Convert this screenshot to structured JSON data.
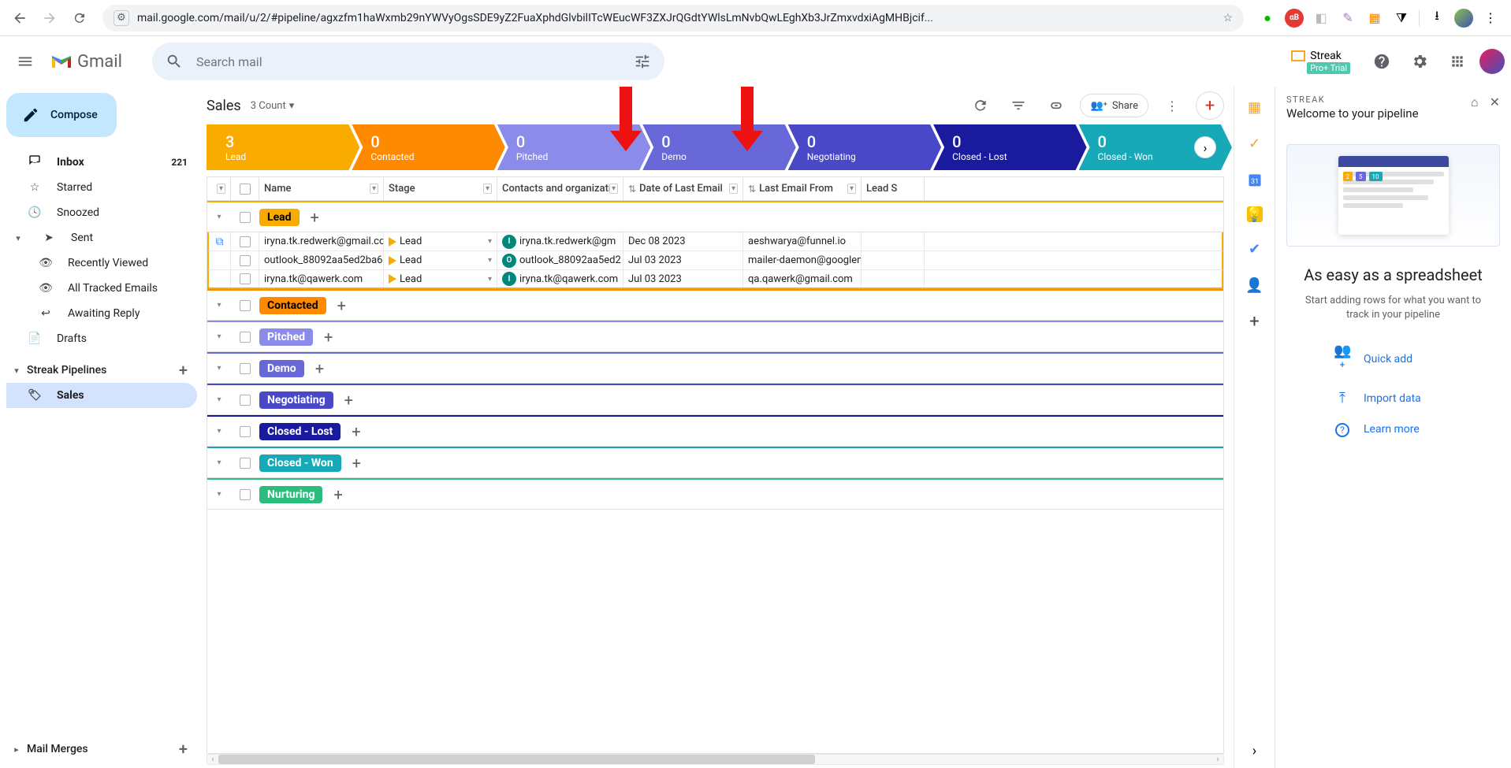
{
  "browser": {
    "url": "mail.google.com/mail/u/2/#pipeline/agxzfm1haWxmb29nYWVyOgsSDE9yZ2FuaXphdGlvbilITcWEucWF3ZXJrQGdtYWlsLmNvbQwLEghXb3JrZmxvdxiAgMHBjcif..."
  },
  "header": {
    "product": "Gmail",
    "search_placeholder": "Search mail",
    "streak_label": "Streak",
    "streak_trial": "Pro+ Trial"
  },
  "sidebar": {
    "compose": "Compose",
    "items": [
      {
        "icon": "inbox",
        "label": "Inbox",
        "count": "221",
        "active": true
      },
      {
        "icon": "star",
        "label": "Starred"
      },
      {
        "icon": "clock",
        "label": "Snoozed"
      },
      {
        "icon": "send",
        "label": "Sent"
      },
      {
        "icon": "eye",
        "label": "Recently Viewed",
        "indent": true
      },
      {
        "icon": "tracked",
        "label": "All Tracked Emails",
        "indent": true
      },
      {
        "icon": "reply",
        "label": "Awaiting Reply",
        "indent": true
      },
      {
        "icon": "draft",
        "label": "Drafts"
      }
    ],
    "pipelines_label": "Streak Pipelines",
    "pipeline_items": [
      {
        "icon": "tag",
        "label": "Sales",
        "active": true
      }
    ],
    "footer_label": "Mail Merges"
  },
  "main": {
    "title": "Sales",
    "count_text": "3 Count",
    "share_label": "Share"
  },
  "funnel": [
    {
      "count": "3",
      "label": "Lead",
      "class": "s0"
    },
    {
      "count": "0",
      "label": "Contacted",
      "class": "s1"
    },
    {
      "count": "0",
      "label": "Pitched",
      "class": "s2"
    },
    {
      "count": "0",
      "label": "Demo",
      "class": "s3"
    },
    {
      "count": "0",
      "label": "Negotiating",
      "class": "s4"
    },
    {
      "count": "0",
      "label": "Closed - Lost",
      "class": "s5"
    },
    {
      "count": "0",
      "label": "Closed - Won",
      "class": "s6"
    }
  ],
  "columns": {
    "name": "Name",
    "stage": "Stage",
    "contacts": "Contacts and organizations",
    "date": "Date of Last Email",
    "from": "Last Email From",
    "lead": "Lead S"
  },
  "groups": [
    {
      "label": "Lead",
      "badge": "badge-lead",
      "border": "lead-border"
    },
    {
      "label": "Contacted",
      "badge": "badge-contacted",
      "border": "border-contacted"
    },
    {
      "label": "Pitched",
      "badge": "badge-pitched",
      "border": "border-pitched"
    },
    {
      "label": "Demo",
      "badge": "badge-demo",
      "border": "border-demo"
    },
    {
      "label": "Negotiating",
      "badge": "badge-negotiating",
      "border": "border-negotiating"
    },
    {
      "label": "Closed - Lost",
      "badge": "badge-closedlost",
      "border": "border-closedlost"
    },
    {
      "label": "Closed - Won",
      "badge": "badge-closedwon",
      "border": "border-closedwon"
    },
    {
      "label": "Nurturing",
      "badge": "badge-nurturing",
      "border": "border-nurturing"
    }
  ],
  "rows": [
    {
      "name": "iryna.tk.redwerk@gmail.com",
      "stage": "Lead",
      "contact_initial": "I",
      "contact": "iryna.tk.redwerk@gm",
      "date": "Dec 08 2023",
      "from": "aeshwarya@funnel.io"
    },
    {
      "name": "outlook_88092aa5ed2ba6",
      "stage": "Lead",
      "contact_initial": "O",
      "contact": "outlook_88092aa5ed2",
      "date": "Jul 03 2023",
      "from": "mailer-daemon@googlem"
    },
    {
      "name": "iryna.tk@qawerk.com",
      "stage": "Lead",
      "contact_initial": "I",
      "contact": "iryna.tk@qawerk.com",
      "date": "Jul 03 2023",
      "from": "qa.qawerk@gmail.com"
    }
  ],
  "panel": {
    "overline": "STREAK",
    "heading": "Welcome to your pipeline",
    "headline": "As easy as a spreadsheet",
    "subtext": "Start adding rows for what you want to track in your pipeline",
    "actions": [
      {
        "icon": "group_add",
        "label": "Quick add"
      },
      {
        "icon": "upload",
        "label": "Import data"
      },
      {
        "icon": "help",
        "label": "Learn more"
      }
    ]
  }
}
